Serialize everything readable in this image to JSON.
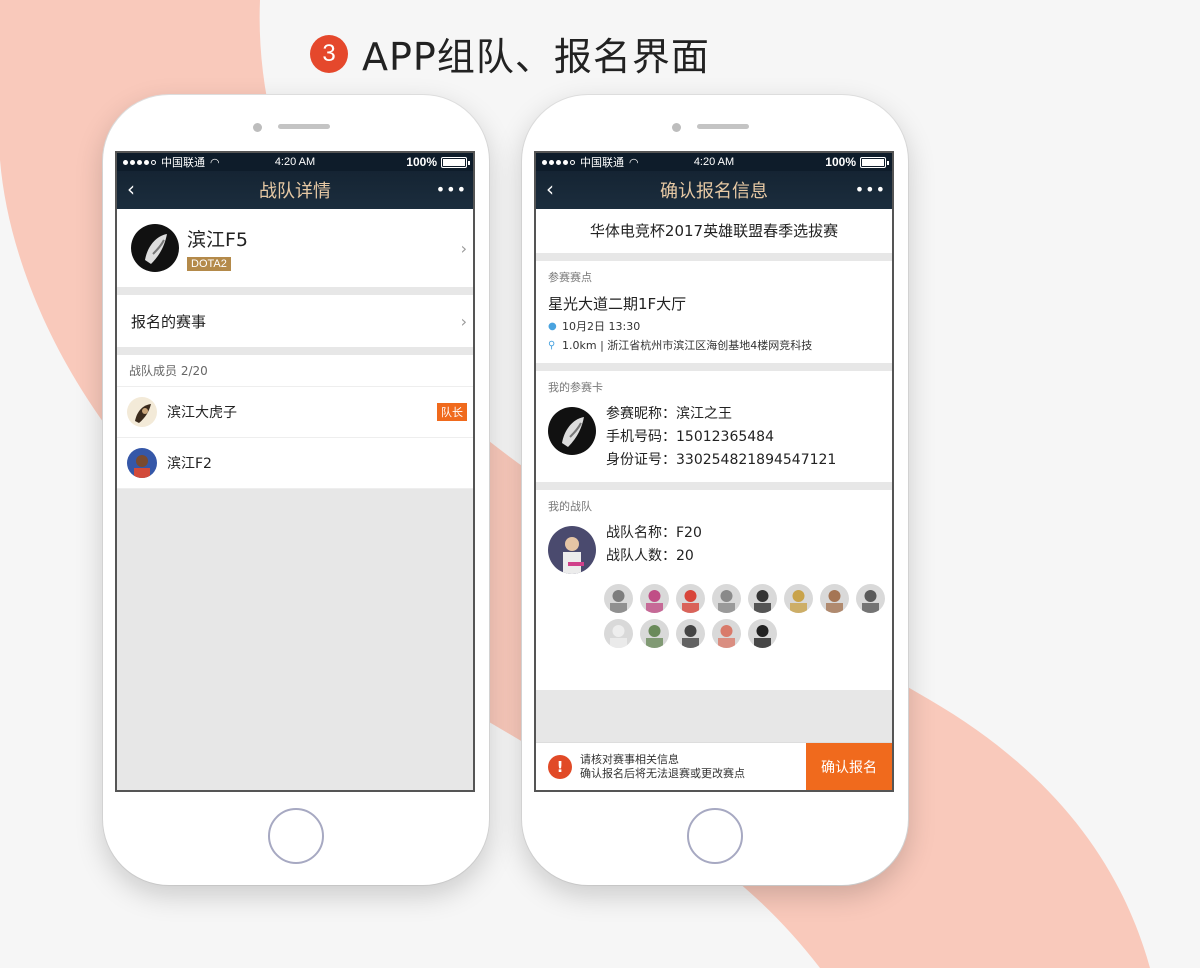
{
  "heading": {
    "number": "3",
    "title": "APP组队、报名界面"
  },
  "status_bar": {
    "carrier": "中国联通",
    "time": "4:20 AM",
    "battery": "100%"
  },
  "left": {
    "nav_title": "战队详情",
    "team_name": "滨江F5",
    "team_game": "DOTA2",
    "events_label": "报名的赛事",
    "members_title": "战队成员 2/20",
    "members": [
      {
        "name": "滨江大虎子",
        "badge": "队长"
      },
      {
        "name": "滨江F2",
        "badge": ""
      }
    ]
  },
  "right": {
    "nav_title": "确认报名信息",
    "event_title": "华体电竞杯2017英雄联盟春季选拔赛",
    "venue": {
      "label": "参赛赛点",
      "name": "星光大道二期1F大厅",
      "datetime": "10月2日 13:30",
      "address": "1.0km | 浙江省杭州市滨江区海创基地4楼网竞科技"
    },
    "player_card": {
      "label": "我的参赛卡",
      "nickname": "参赛昵称：滨江之王",
      "phone": "手机号码：15012365484",
      "id_number": "身份证号：330254821894547121"
    },
    "my_team": {
      "label": "我的战队",
      "team_name": "战队名称：F20",
      "team_size": "战队人数：20",
      "member_count_shown": 13
    },
    "notice_line1": "请核对赛事相关信息",
    "notice_line2": "确认报名后将无法退赛或更改赛点",
    "confirm_label": "确认报名"
  },
  "colors": {
    "accent": "#f06a1d",
    "nav_bg": "#152433",
    "nav_title": "#e7c9a4",
    "bg_swoosh": "#f7c5b7"
  }
}
